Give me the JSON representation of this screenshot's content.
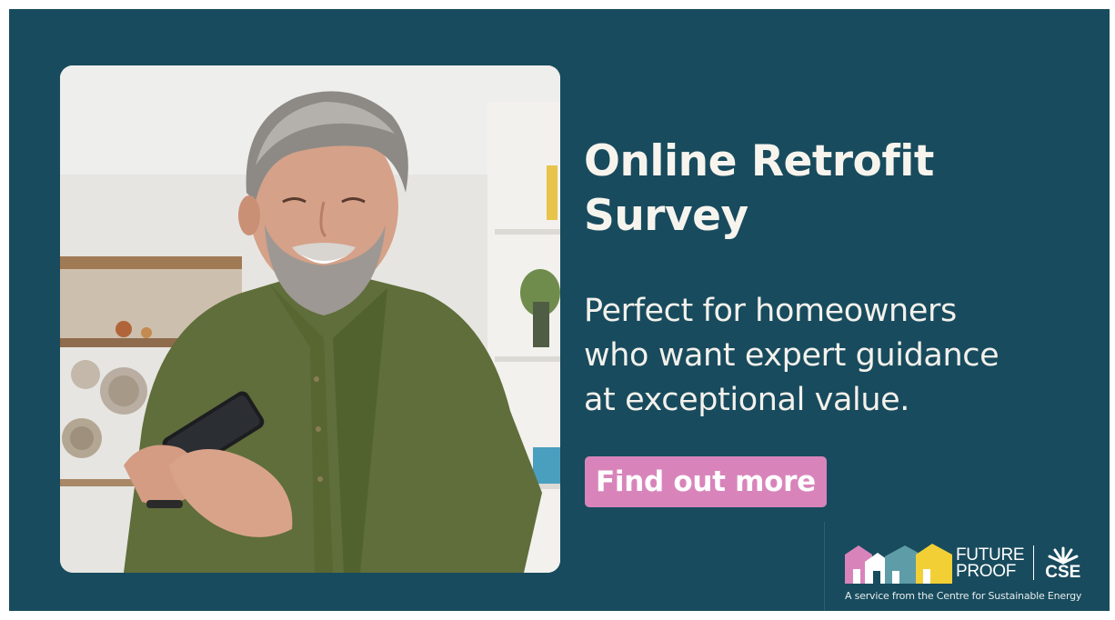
{
  "headline": {
    "line1": "Online Retrofit",
    "line2": "Survey"
  },
  "subcopy": {
    "line1": "Perfect for homeowners",
    "line2": "who want expert guidance",
    "line3": "at exceptional value."
  },
  "cta": {
    "label": "Find out more"
  },
  "logo": {
    "brand_line1": "FUTURE",
    "brand_line2": "PROOF",
    "partner": "CSE",
    "tagline": "A service from the Centre for Sustainable Energy"
  },
  "photo": {
    "subject": "man-using-smartphone-photo"
  },
  "colors": {
    "background": "#184b5d",
    "button": "#d884bb",
    "text": "#f7f4ee",
    "house_pink": "#d884bb",
    "house_teal": "#5e9ca8",
    "house_yellow": "#f3cf36"
  }
}
